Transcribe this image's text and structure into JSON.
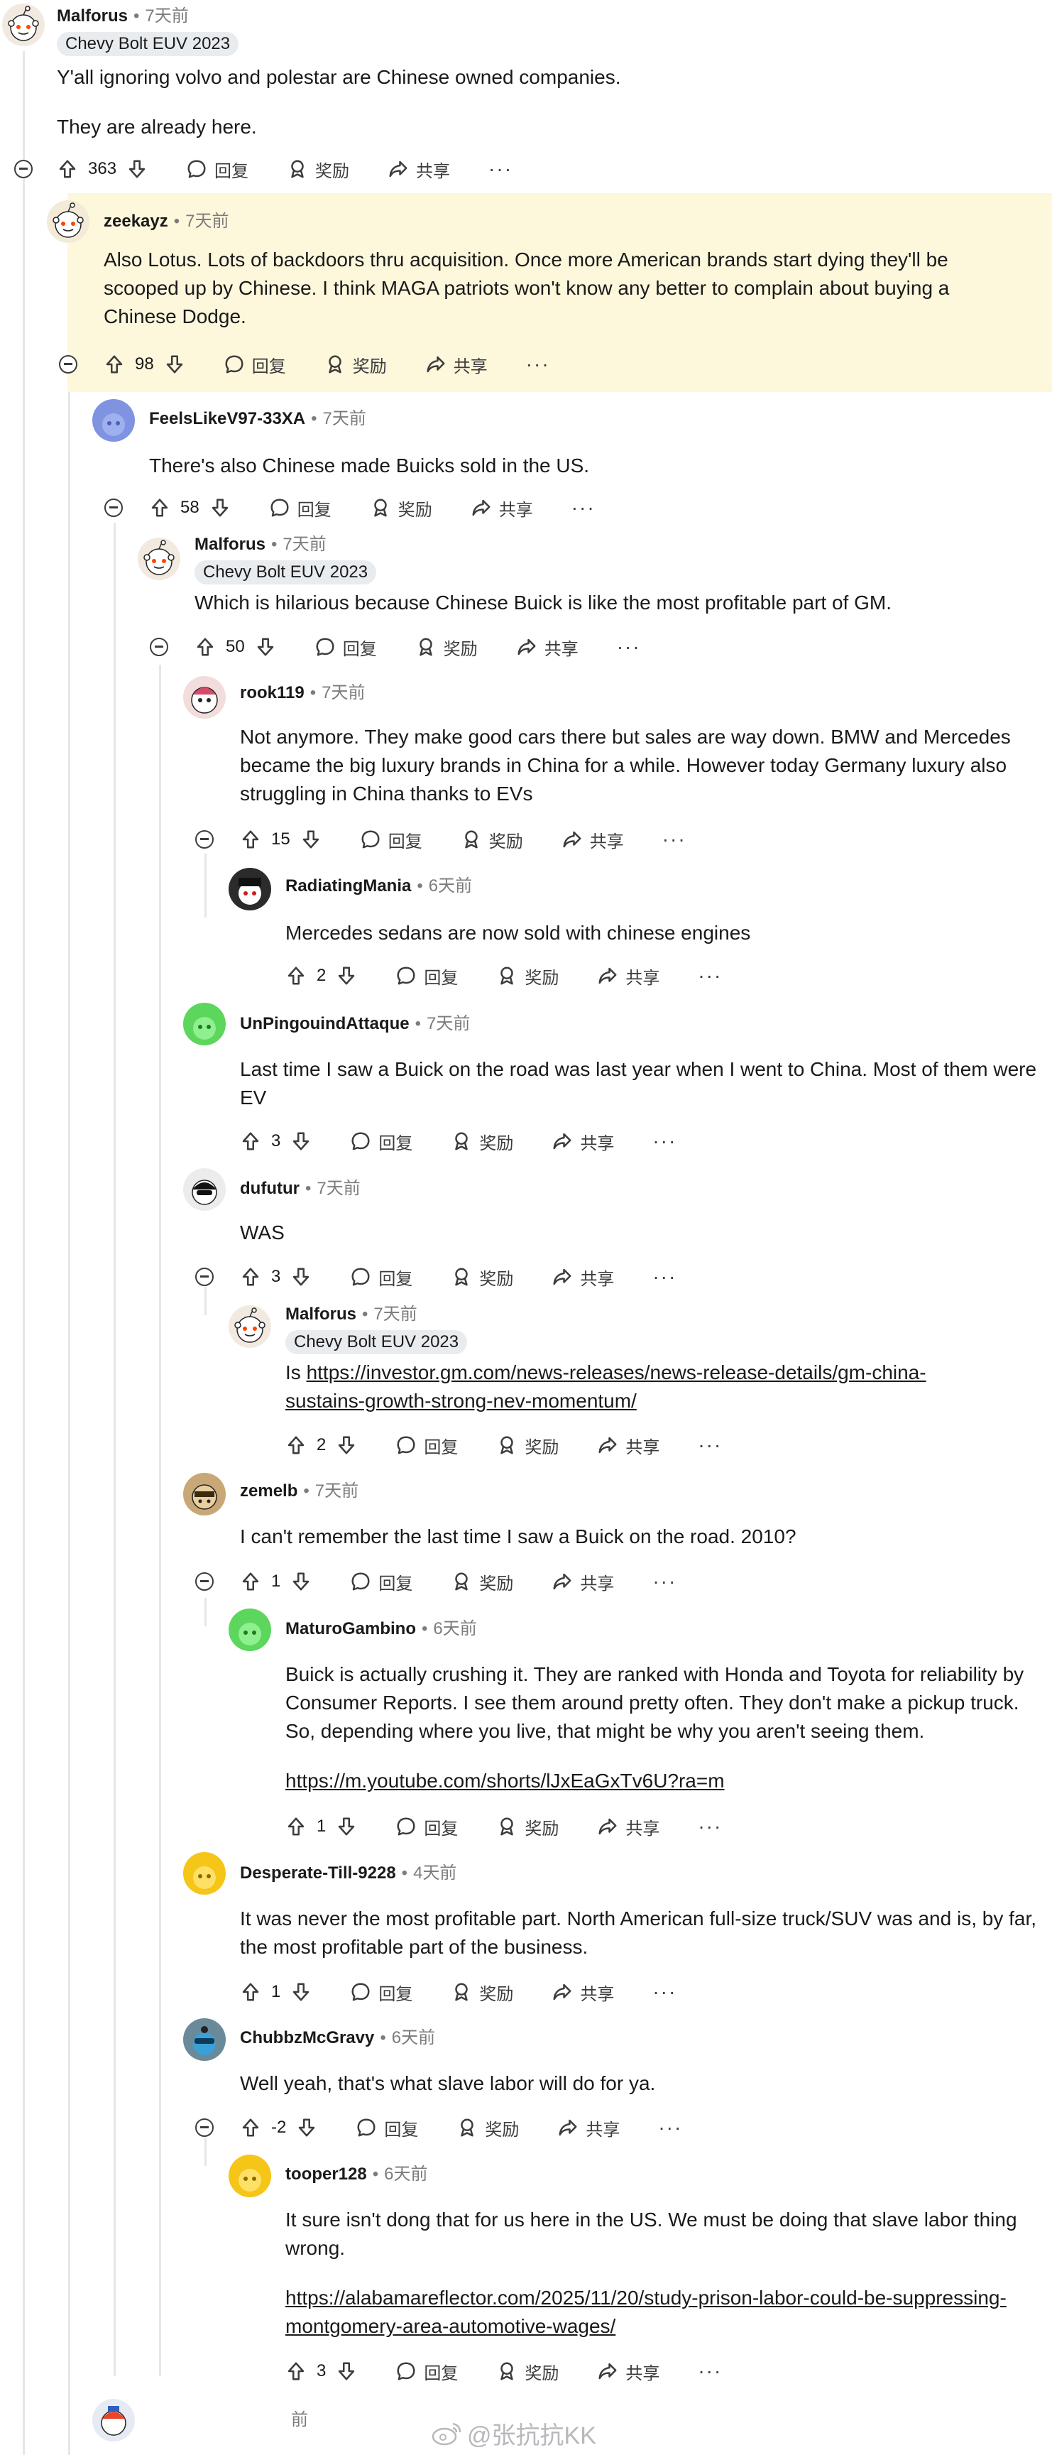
{
  "labels": {
    "reply": "回复",
    "award": "奖励",
    "share": "共享",
    "more": "···"
  },
  "comments": [
    {
      "author": "Malforus",
      "time": "7天前",
      "flair": "Chevy Bolt EUV 2023",
      "body_lines": [
        "Y'all ignoring volvo and polestar are Chinese owned companies.",
        "They are already here."
      ],
      "score": "363"
    },
    {
      "author": "zeekayz",
      "time": "7天前",
      "body_lines": [
        "Also Lotus. Lots of backdoors thru acquisition. Once more American brands start dying they'll be scooped up by Chinese. I think MAGA patriots won't know any better to complain about buying a Chinese Dodge."
      ],
      "score": "98"
    },
    {
      "author": "FeelsLikeV97-33XA",
      "time": "7天前",
      "body_lines": [
        "There's also Chinese made Buicks sold in the US."
      ],
      "score": "58"
    },
    {
      "author": "Malforus",
      "time": "7天前",
      "flair": "Chevy Bolt EUV 2023",
      "body_lines": [
        "Which is hilarious because Chinese Buick is like the most profitable part of GM."
      ],
      "score": "50"
    },
    {
      "author": "rook119",
      "time": "7天前",
      "body_lines": [
        "Not anymore. They make good cars there but sales are way down. BMW and Mercedes became the big luxury brands in China for a while. However today Germany luxury also struggling in China thanks to EVs"
      ],
      "score": "15"
    },
    {
      "author": "RadiatingMania",
      "time": "6天前",
      "body_lines": [
        "Mercedes sedans are now sold with chinese engines"
      ],
      "score": "2"
    },
    {
      "author": "UnPingouindAttaque",
      "time": "7天前",
      "body_lines": [
        "Last time I saw a Buick on the road was last year when I went to China. Most of them were EV"
      ],
      "score": "3"
    },
    {
      "author": "dufutur",
      "time": "7天前",
      "body_lines": [
        "WAS"
      ],
      "score": "3"
    },
    {
      "author": "Malforus",
      "time": "7天前",
      "flair": "Chevy Bolt EUV 2023",
      "body_prefix": "Is ",
      "link": "https://investor.gm.com/news-releases/news-release-details/gm-china-sustains-growth-strong-nev-momentum/",
      "score": "2"
    },
    {
      "author": "zemelb",
      "time": "7天前",
      "body_lines": [
        "I can't remember the last time I saw a Buick on the road. 2010?"
      ],
      "score": "1"
    },
    {
      "author": "MaturoGambino",
      "time": "6天前",
      "body_lines": [
        "Buick is actually crushing it. They are ranked with Honda and Toyota for reliability by Consumer Reports. I see them around pretty often. They don't make a pickup truck. So, depending where you live, that might be why you aren't seeing them."
      ],
      "link": "https://m.youtube.com/shorts/lJxEaGxTv6U?ra=m",
      "score": "1"
    },
    {
      "author": "Desperate-Till-9228",
      "time": "4天前",
      "body_lines": [
        "It was never the most profitable part. North American full-size truck/SUV was and is, by far, the most profitable part of the business."
      ],
      "score": "1"
    },
    {
      "author": "ChubbzMcGravy",
      "time": "6天前",
      "body_lines": [
        "Well yeah, that's what slave labor will do for ya."
      ],
      "score": "-2"
    },
    {
      "author": "tooper128",
      "time": "6天前",
      "body_lines": [
        "It sure isn't dong that for us here in the US. We must be doing that slave labor thing wrong."
      ],
      "link": "https://alabamareflector.com/2025/11/20/study-prison-labor-could-be-suppressing-montgomery-area-automotive-wages/",
      "score": "3"
    }
  ],
  "partial": {
    "time": "前"
  },
  "watermark": "@张抗抗KK",
  "colors": {
    "highlight": "#fdf7dc",
    "thread_line": "#e4e7ea",
    "flair_bg": "#e9ecef",
    "meta_gray": "#7c7c7c"
  },
  "icons": [
    "upvote-icon",
    "downvote-icon",
    "reply-icon",
    "award-icon",
    "share-icon",
    "collapse-icon",
    "weibo-icon"
  ]
}
